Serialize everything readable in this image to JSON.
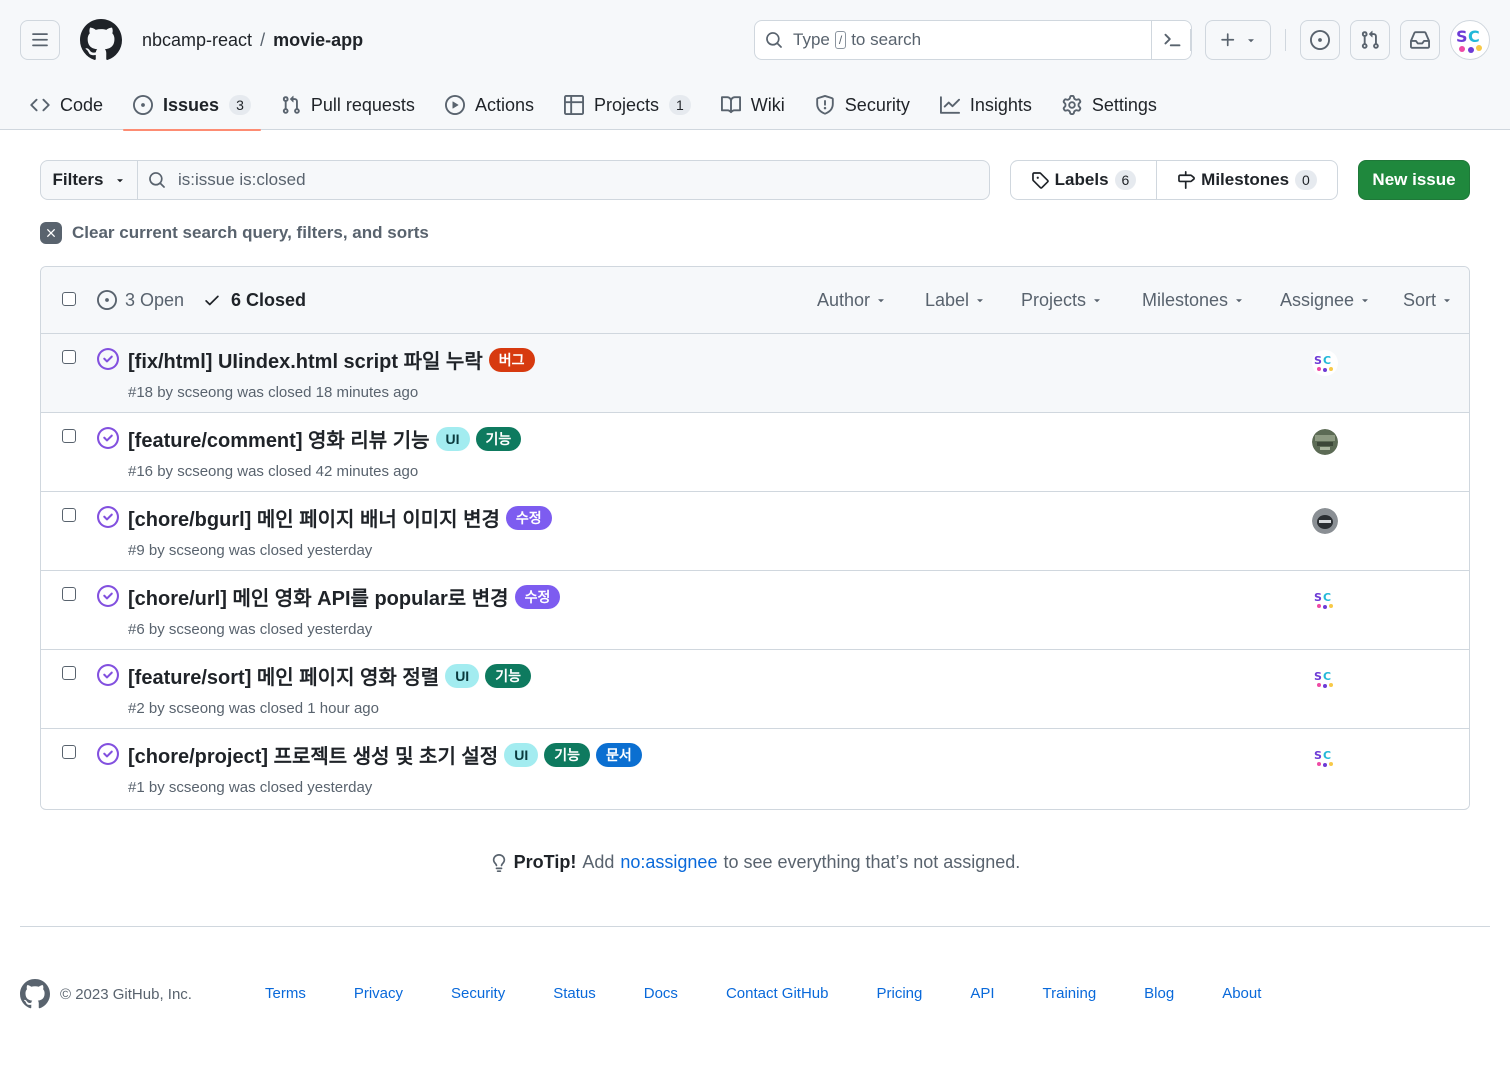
{
  "header": {
    "repo_owner": "nbcamp-react",
    "repo_separator": "/",
    "repo_name": "movie-app",
    "search_type": "Type",
    "search_key": "/",
    "search_rest": "to search"
  },
  "nav": [
    {
      "label": "Code",
      "icon": "code-icon"
    },
    {
      "label": "Issues",
      "icon": "issue-opened-icon",
      "count": "3",
      "active": true
    },
    {
      "label": "Pull requests",
      "icon": "git-pull-request-icon"
    },
    {
      "label": "Actions",
      "icon": "play-icon"
    },
    {
      "label": "Projects",
      "icon": "table-icon",
      "count": "1"
    },
    {
      "label": "Wiki",
      "icon": "book-icon"
    },
    {
      "label": "Security",
      "icon": "shield-icon"
    },
    {
      "label": "Insights",
      "icon": "graph-icon"
    },
    {
      "label": "Settings",
      "icon": "gear-icon"
    }
  ],
  "toolbar": {
    "filters_label": "Filters",
    "query": "is:issue is:closed",
    "labels_label": "Labels",
    "labels_count": "6",
    "milestones_label": "Milestones",
    "milestones_count": "0",
    "new_issue_label": "New issue",
    "clear_query_label": "Clear current search query, filters, and sorts"
  },
  "list_header": {
    "open_label": "3 Open",
    "closed_label": "6 Closed",
    "selectors": [
      "Author",
      "Label",
      "Projects",
      "Milestones",
      "Assignee",
      "Sort"
    ]
  },
  "colors": {
    "closed_icon": "#8250df",
    "primary_button": "#1f883d",
    "link": "#0969da",
    "active_tab_underline": "#fd8c73"
  },
  "issues": [
    {
      "title": "[fix/html] UIindex.html script 파일 누락",
      "labels": [
        {
          "name": "버그",
          "bg": "#d73a0f",
          "fg": "#ffffff"
        }
      ],
      "meta": "#18 by scseong was closed 18 minutes ago",
      "avatar": "sc-avatar"
    },
    {
      "title": "[feature/comment] 영화 리뷰 기능",
      "labels": [
        {
          "name": "UI",
          "bg": "#a3ecf0",
          "fg": "#0a3a3d"
        },
        {
          "name": "기능",
          "bg": "#0e7a5f",
          "fg": "#ffffff"
        }
      ],
      "meta": "#16 by scseong was closed 42 minutes ago",
      "avatar": "photo-avatar"
    },
    {
      "title": "[chore/bgurl] 메인 페이지 배너 이미지 변경",
      "labels": [
        {
          "name": "수정",
          "bg": "#7d5cf0",
          "fg": "#ffffff"
        }
      ],
      "meta": "#9 by scseong was closed yesterday",
      "avatar": "helmet-avatar"
    },
    {
      "title": "[chore/url] 메인 영화 API를 popular로 변경",
      "labels": [
        {
          "name": "수정",
          "bg": "#7d5cf0",
          "fg": "#ffffff"
        }
      ],
      "meta": "#6 by scseong was closed yesterday",
      "avatar": "sc-avatar"
    },
    {
      "title": "[feature/sort] 메인 페이지 영화 정렬",
      "labels": [
        {
          "name": "UI",
          "bg": "#a3ecf0",
          "fg": "#0a3a3d"
        },
        {
          "name": "기능",
          "bg": "#0e7a5f",
          "fg": "#ffffff"
        }
      ],
      "meta": "#2 by scseong was closed 1 hour ago",
      "avatar": "sc-avatar"
    },
    {
      "title": "[chore/project] 프로젝트 생성 및 초기 설정",
      "labels": [
        {
          "name": "UI",
          "bg": "#a3ecf0",
          "fg": "#0a3a3d"
        },
        {
          "name": "기능",
          "bg": "#0e7a5f",
          "fg": "#ffffff"
        },
        {
          "name": "문서",
          "bg": "#0b6fd1",
          "fg": "#ffffff"
        }
      ],
      "meta": "#1 by scseong was closed yesterday",
      "avatar": "sc-avatar"
    }
  ],
  "protip": {
    "prefix": "ProTip!",
    "text1": "Add",
    "link": "no:assignee",
    "text2": "to see everything that’s not assigned."
  },
  "footer": {
    "copyright": "© 2023 GitHub, Inc.",
    "links": [
      "Terms",
      "Privacy",
      "Security",
      "Status",
      "Docs",
      "Contact GitHub",
      "Pricing",
      "API",
      "Training",
      "Blog",
      "About"
    ]
  }
}
